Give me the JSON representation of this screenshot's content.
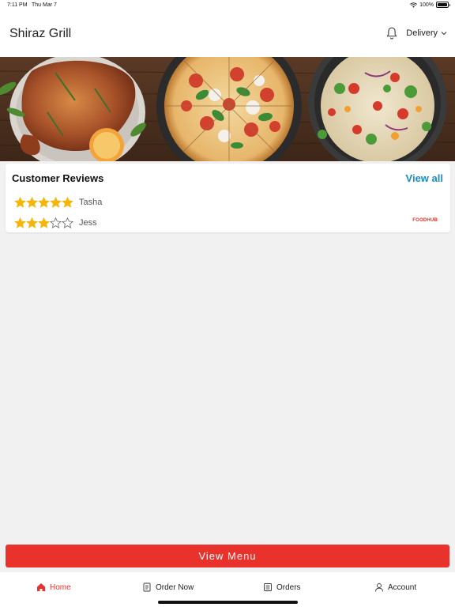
{
  "status_bar": {
    "time": "7:11 PM",
    "date": "Thu Mar 7",
    "battery": "100%",
    "battery_level": 1.0
  },
  "header": {
    "title": "Shiraz Grill",
    "mode_label": "Delivery",
    "icons": [
      "bell-icon",
      "chevron-down-icon"
    ]
  },
  "banner": {
    "images": [
      "roast-chicken",
      "pizza",
      "pasta-salad"
    ]
  },
  "reviews": {
    "title": "Customer Reviews",
    "view_all": "View all",
    "items": [
      {
        "name": "Tasha",
        "rating": 5,
        "max": 5
      },
      {
        "name": "Jess",
        "rating": 3,
        "max": 5
      }
    ],
    "source": "FOODHUB"
  },
  "view_menu_label": "View Menu",
  "tabs": [
    {
      "label": "Home",
      "icon": "home-icon",
      "active": true
    },
    {
      "label": "Order Now",
      "icon": "receipt-icon",
      "active": false
    },
    {
      "label": "Orders",
      "icon": "list-icon",
      "active": false
    },
    {
      "label": "Account",
      "icon": "user-icon",
      "active": false
    }
  ],
  "colors": {
    "accent": "#e8322b",
    "link": "#1a8ec0",
    "star": "#f5b50a"
  }
}
